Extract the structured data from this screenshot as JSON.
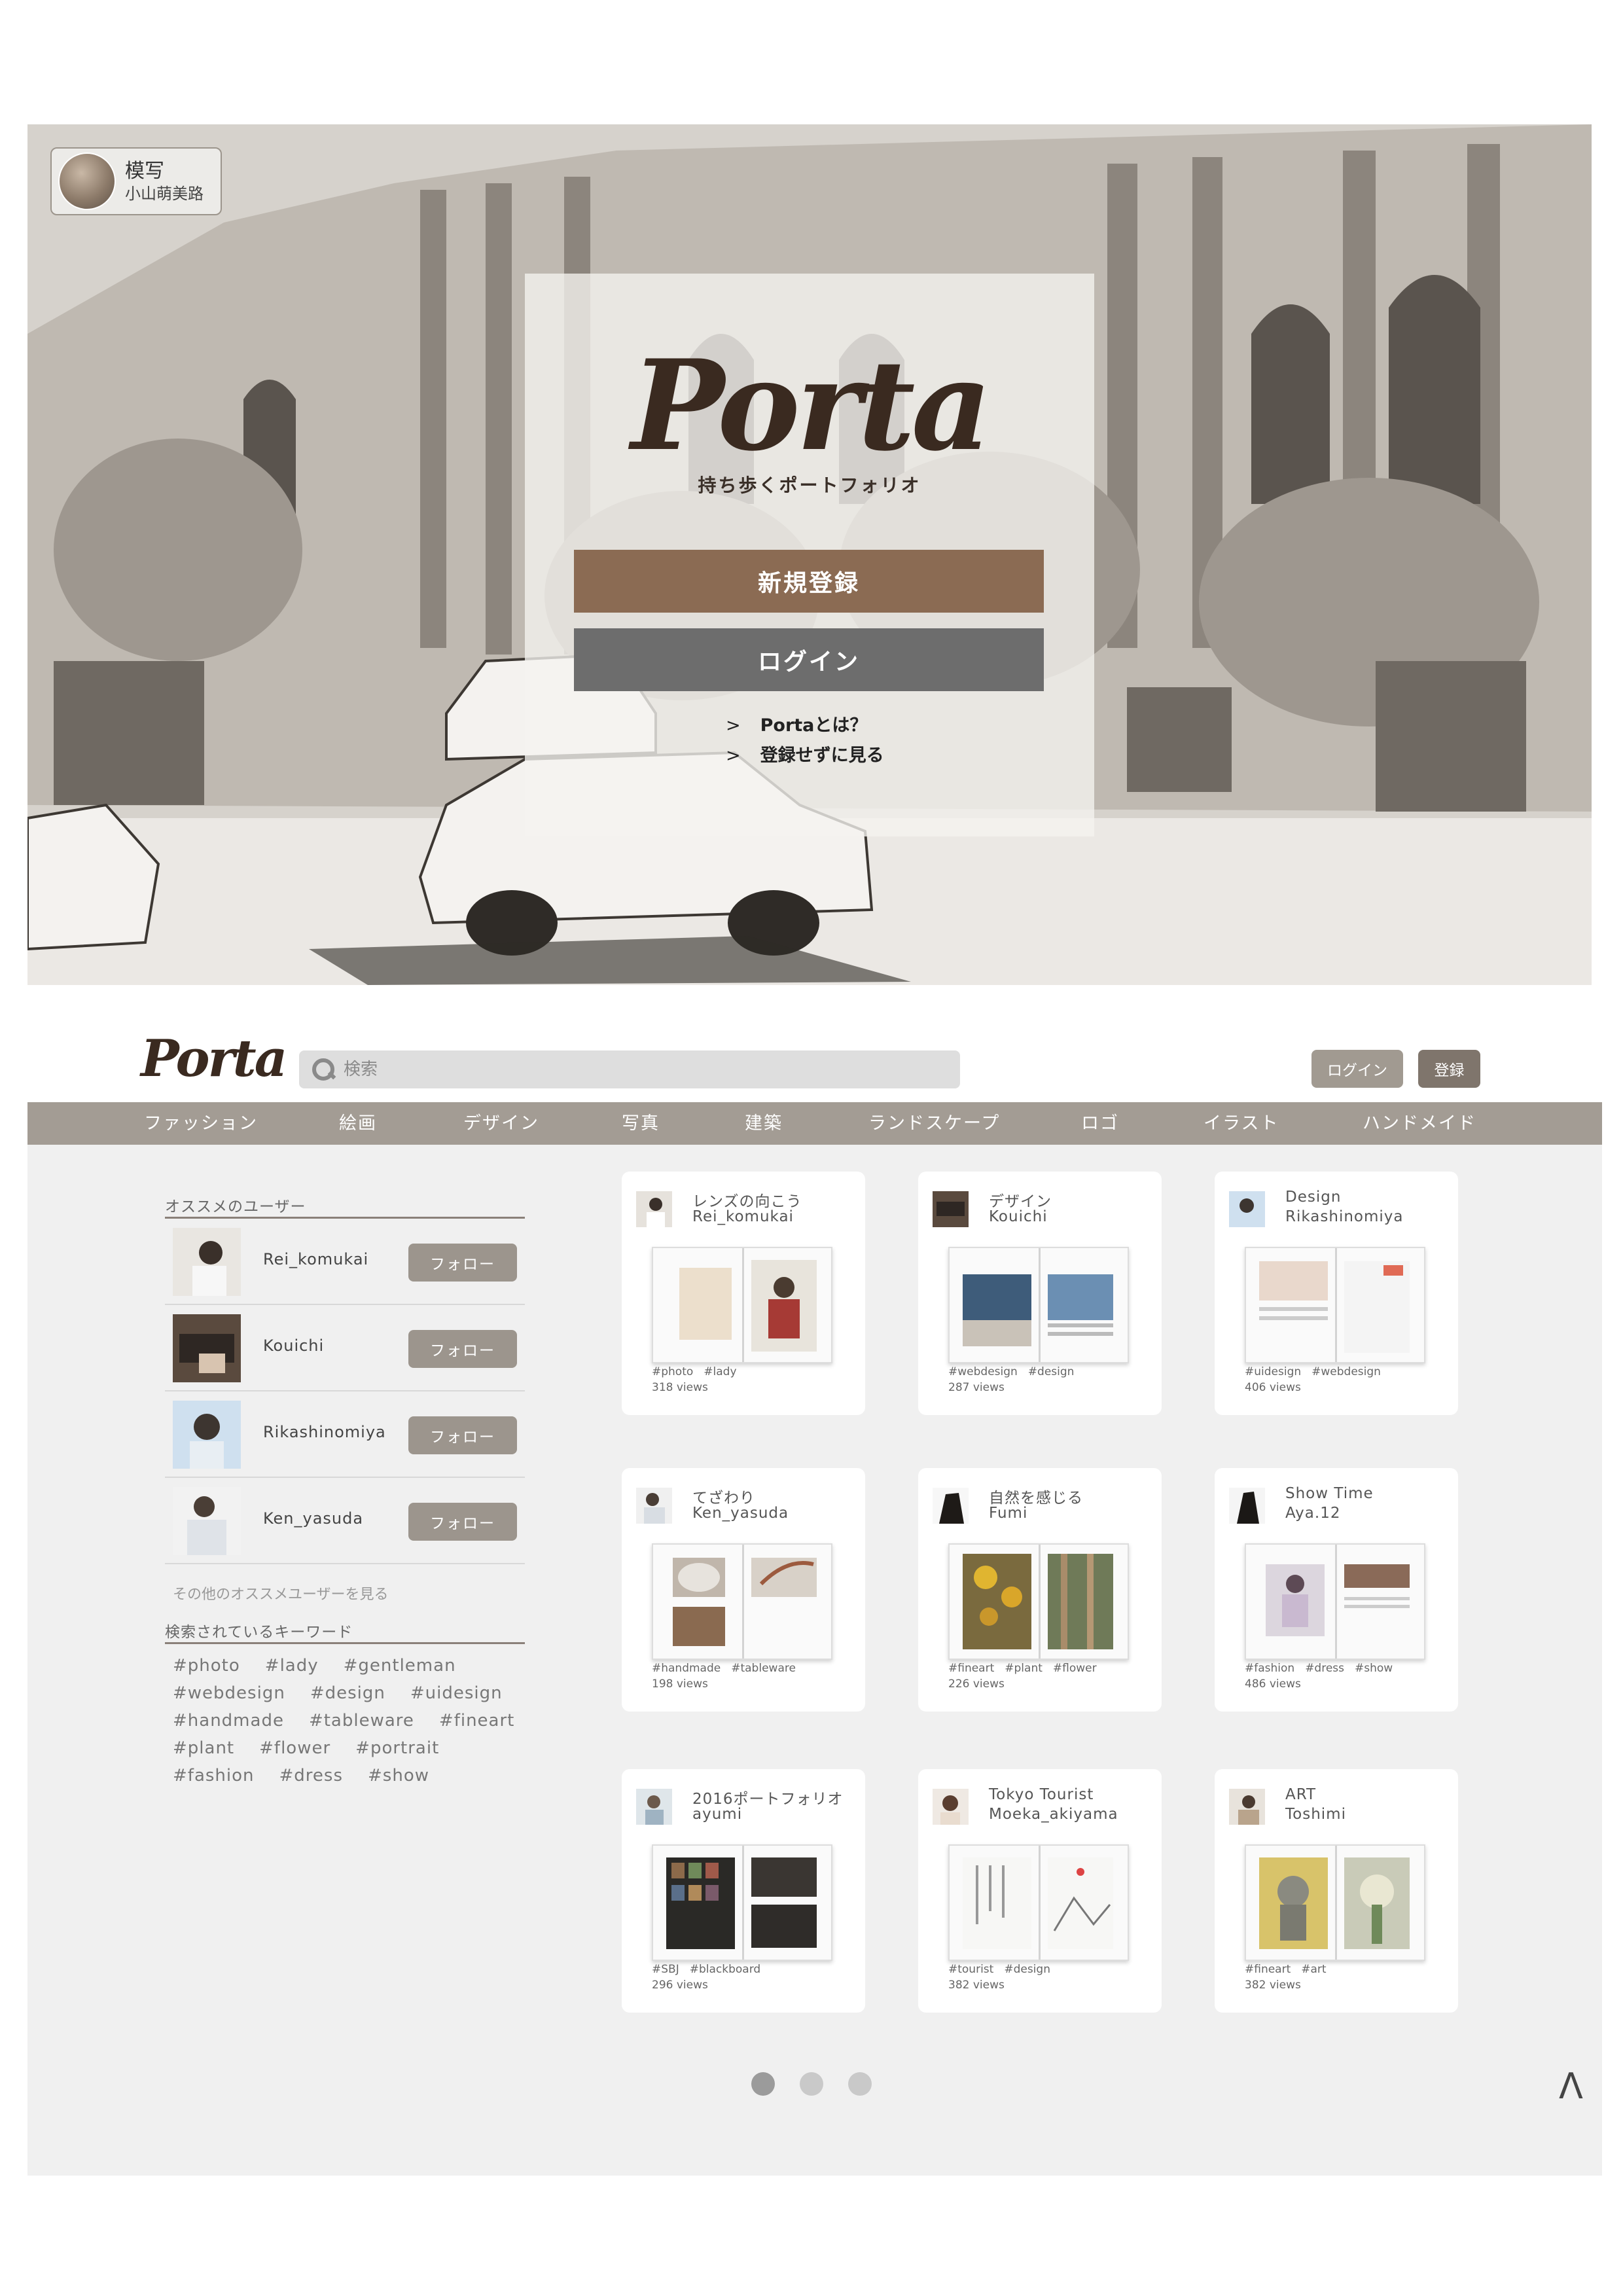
{
  "hero": {
    "credit": {
      "title": "模写",
      "author": "小山萌美路"
    },
    "logo": "Porta",
    "tagline": "持ち歩くポートフォリオ",
    "register_label": "新規登録",
    "login_label": "ログイン",
    "links": [
      {
        "arrow": ">",
        "label": "Portaとは？"
      },
      {
        "arrow": ">",
        "label": "登録せずに見る"
      }
    ]
  },
  "header": {
    "logo": "Porta",
    "search_placeholder": "検索",
    "login_label": "ログイン",
    "register_label": "登録"
  },
  "categories": [
    "ファッション",
    "絵画",
    "デザイン",
    "写真",
    "建築",
    "ランドスケープ",
    "ロゴ",
    "イラスト",
    "ハンドメイド"
  ],
  "sidebar": {
    "recommended_title": "オススメのユーザー",
    "follow_label": "フォロー",
    "users": [
      "Rei_komukai",
      "Kouichi",
      "Rikashinomiya",
      "Ken_yasuda"
    ],
    "more_users": "その他のオススメユーザーを見る",
    "keywords_title": "検索されているキーワード",
    "keyword_lines": [
      [
        "#photo",
        "#lady",
        "#gentleman"
      ],
      [
        "#webdesign",
        "#design",
        "#uidesign"
      ],
      [
        "#handmade",
        "#tableware",
        "#fineart"
      ],
      [
        "#plant",
        "#flower",
        "#portrait"
      ],
      [
        "#fashion",
        "#dress",
        "#show"
      ]
    ]
  },
  "cards": [
    {
      "title": "レンズの向こう",
      "user": "Rei_komukai",
      "tags": [
        "#photo",
        "#lady"
      ],
      "views": "318 views"
    },
    {
      "title": "デザイン",
      "user": "Kouichi",
      "tags": [
        "#webdesign",
        "#design"
      ],
      "views": "287 views"
    },
    {
      "title": "Design",
      "user": "Rikashinomiya",
      "tags": [
        "#uidesign",
        "#webdesign"
      ],
      "views": "406 views"
    },
    {
      "title": "てざわり",
      "user": "Ken_yasuda",
      "tags": [
        "#handmade",
        "#tableware"
      ],
      "views": "198 views"
    },
    {
      "title": "自然を感じる",
      "user": "Fumi",
      "tags": [
        "#fineart",
        "#plant",
        "#flower"
      ],
      "views": "226 views"
    },
    {
      "title": "Show Time",
      "user": "Aya.12",
      "tags": [
        "#fashion",
        "#dress",
        "#show"
      ],
      "views": "486 views"
    },
    {
      "title": "2016ポートフォリオ",
      "user": "ayumi",
      "tags": [
        "#SBJ",
        "#blackboard"
      ],
      "views": "296 views"
    },
    {
      "title": "Tokyo Tourist",
      "user": "Moeka_akiyama",
      "tags": [
        "#tourist",
        "#design"
      ],
      "views": "382 views"
    },
    {
      "title": "ART",
      "user": "Toshimi",
      "tags": [
        "#fineart",
        "#art"
      ],
      "views": "382 views"
    }
  ],
  "pagination": {
    "pages": 3,
    "current": 1
  },
  "back_to_top": "Λ",
  "colors": {
    "register_brown": "#8b6b53",
    "login_gray": "#6d6d6d",
    "category_bar": "#a39c94",
    "follow_button": "#9c958d",
    "app_background": "#f0f0f0"
  }
}
